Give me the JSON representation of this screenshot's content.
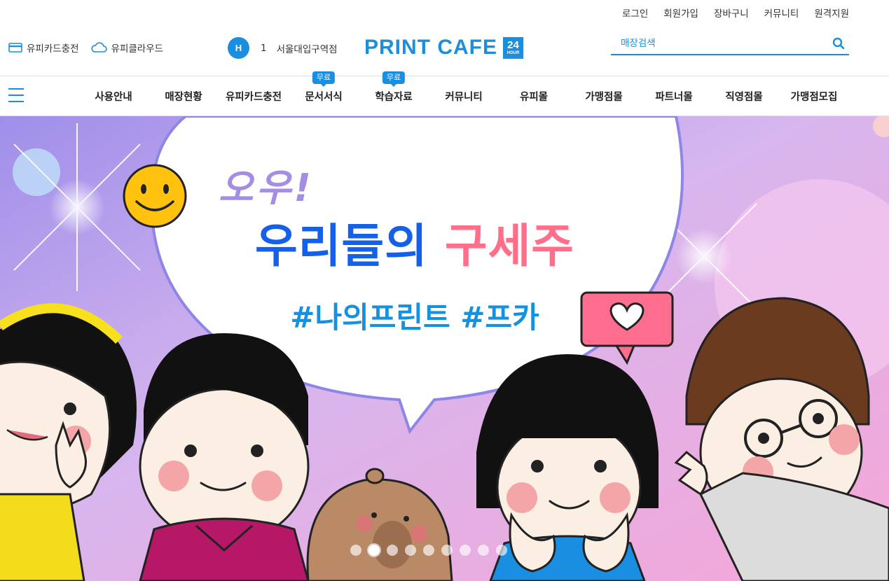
{
  "util_links": [
    "로그인",
    "회원가입",
    "장바구니",
    "커뮤니티",
    "원격지원"
  ],
  "header": {
    "card_charge": "유피카드충전",
    "cloud": "유피클라우드",
    "store_badge": "H",
    "store_number": "1",
    "store_name": "서울대입구역점",
    "logo_text": "PRINT CAFE",
    "logo_badge_num": "24",
    "logo_badge_sub": "HOUR",
    "search_placeholder": "매장검색"
  },
  "nav": [
    {
      "label": "사용안내",
      "tag": ""
    },
    {
      "label": "매장현황",
      "tag": ""
    },
    {
      "label": "유피카드충전",
      "tag": ""
    },
    {
      "label": "문서서식",
      "tag": "무료"
    },
    {
      "label": "학습자료",
      "tag": "무료"
    },
    {
      "label": "커뮤니티",
      "tag": ""
    },
    {
      "label": "유피몰",
      "tag": ""
    },
    {
      "label": "가맹점몰",
      "tag": ""
    },
    {
      "label": "파트너몰",
      "tag": ""
    },
    {
      "label": "직영점몰",
      "tag": ""
    },
    {
      "label": "가맹점모집",
      "tag": ""
    }
  ],
  "banner": {
    "wow": "오우!",
    "title_blue": "우리들의",
    "title_pink": "구세주",
    "hashtags": "#나의프린트 #프카",
    "slide_count": 9,
    "active_slide": 2
  },
  "colors": {
    "accent": "#1a8ee0",
    "logo": "#1b8fdb",
    "title_blue": "#1560e8",
    "title_pink": "#ff6f8a"
  }
}
